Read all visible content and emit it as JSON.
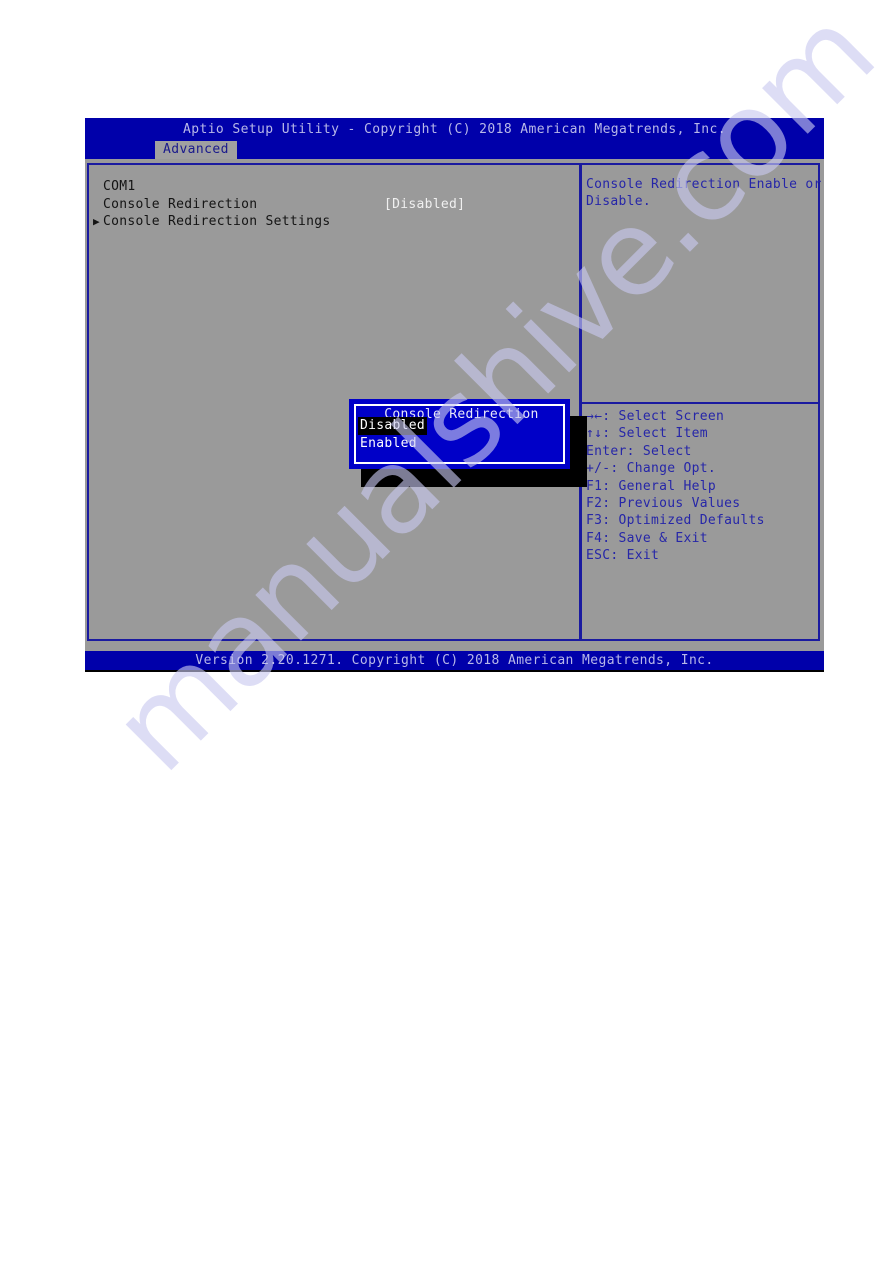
{
  "title_bar": {
    "text": "Aptio Setup Utility - Copyright (C) 2018 American Megatrends, Inc."
  },
  "tabs": [
    {
      "label": "Advanced",
      "active": true
    }
  ],
  "left_pane": {
    "rows": [
      {
        "name": "com1-group-label",
        "label": "COM1",
        "value": "",
        "arrow": ""
      },
      {
        "name": "console-redirection",
        "label": "Console Redirection",
        "value": "[Disabled]",
        "arrow": ""
      },
      {
        "name": "console-redirection-settings",
        "label": "Console Redirection Settings",
        "value": "",
        "arrow": "▶"
      }
    ]
  },
  "right_pane": {
    "help": [
      "Console Redirection Enable or",
      "Disable."
    ],
    "keys": [
      "→←: Select Screen",
      "↑↓: Select Item",
      "Enter: Select",
      "+/-: Change Opt.",
      "F1: General Help",
      "F2: Previous Values",
      "F3: Optimized Defaults",
      "F4: Save & Exit",
      "ESC: Exit"
    ]
  },
  "dialog": {
    "title": "Console Redirection",
    "options": [
      {
        "label": "Disabled",
        "selected": true
      },
      {
        "label": "Enabled",
        "selected": false
      }
    ]
  },
  "footer": {
    "text": "Version 2.20.1271. Copyright (C) 2018 American Megatrends, Inc."
  },
  "watermark": {
    "text": "manualshive.com"
  },
  "colors": {
    "screen_blue": "#0000aa",
    "dialog_blue": "#0000c8",
    "panel_gray": "#9a9a9a",
    "border_blue": "#1a1aa0",
    "help_text_blue": "#2626a8",
    "title_text": "#b8b8e8",
    "row_text": "#141414",
    "value_text": "#f0f0f0",
    "watermark": "#c9c9f0"
  }
}
